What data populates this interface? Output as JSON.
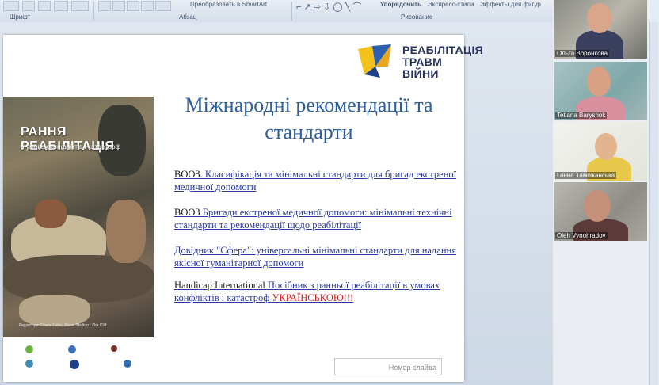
{
  "ribbon": {
    "groups": [
      "Шрифт",
      "Абзац",
      "Рисование"
    ],
    "convert_smartart": "Преобразовать в SmartArt",
    "arrange": "Упорядочить",
    "quick_styles": "Экспресс-стили",
    "shape_effects": "Эффекты для фигур"
  },
  "slide": {
    "logo_lines": [
      "РЕАБІЛІТАЦІЯ",
      "ТРАВМ",
      "ВІЙНИ"
    ],
    "title": "Міжнародні рекомендації та стандарти",
    "cover": {
      "title": "РАННЯ РЕАБІЛІТАЦІЯ",
      "subtitle": "в умовах конфліктів і катастроф",
      "credit": "Редактори: Dhemi Lahiu, Peter Skelton i Zha Cliff"
    },
    "links": [
      {
        "pre": "ВООЗ",
        "text": ". Класифікація та мінімальні стандарти для бригад екстреної медичної допомоги",
        "hl": ""
      },
      {
        "pre": "ВООЗ",
        "text": " Бригади екстреної медичної допомоги: мінімальні технічні стандарти та рекомендації щодо реабілітації",
        "hl": ""
      },
      {
        "pre": "",
        "text": "Довідник \"Сфера\": універсальні мінімальні стандарти для надання якісної гуманітарної допомоги",
        "hl": ""
      },
      {
        "pre": "Handicap International",
        "text": "  Посібник з ранньої реабілітації  в умовах конфліктів  і катастроф ",
        "hl": "УКРАЇНСЬКОЮ!!!"
      }
    ],
    "slide_number_placeholder": "Номер слайда"
  },
  "participants": [
    {
      "name": "Ольга Воронкова"
    },
    {
      "name": "Tetiana Baryshok"
    },
    {
      "name": "Ганна Таможанська"
    },
    {
      "name": "Oleh Vynohradov"
    }
  ]
}
